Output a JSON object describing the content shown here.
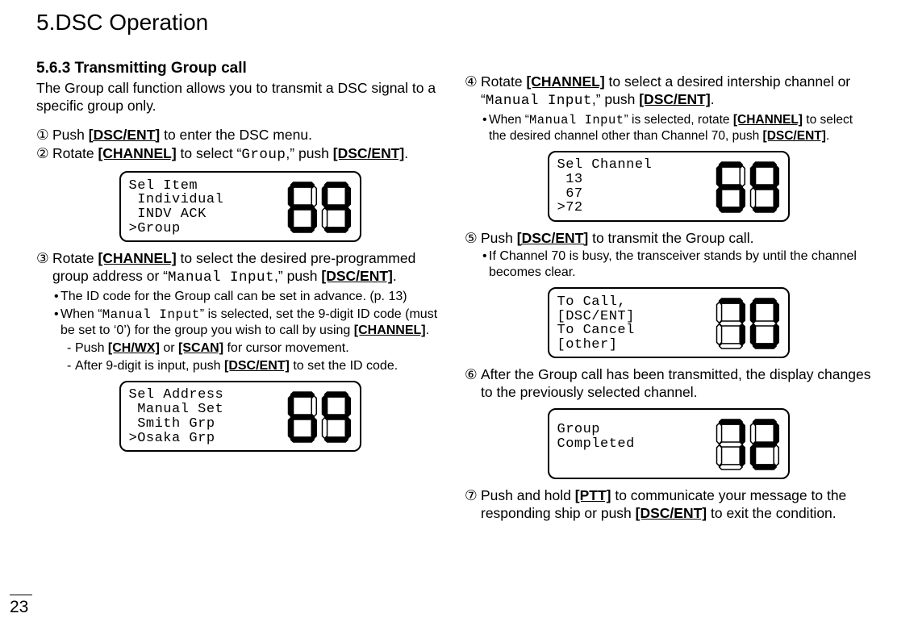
{
  "chapter_title": "5.DSC Operation",
  "section_title": "5.6.3 Transmitting Group call",
  "intro": "The Group call function allows you to transmit a DSC signal to a specific group only.",
  "page_number": "23",
  "keys": {
    "dsc_ent": "[DSC/ENT]",
    "channel": "[CHANNEL]",
    "ch_wx": "[CH/WX]",
    "scan": "[SCAN]",
    "ptt": "[PTT]"
  },
  "mono": {
    "group": "Group",
    "manual_input": "Manual Input"
  },
  "steps": {
    "s1_num": "①",
    "s1_a": "Push ",
    "s1_b": " to enter the DSC menu.",
    "s2_num": "②",
    "s2_a": "Rotate ",
    "s2_b": " to select “",
    "s2_c": ",” push ",
    "s2_d": ".",
    "s3_num": "③",
    "s3_a": "Rotate ",
    "s3_b": " to select the desired pre-programmed group address or “",
    "s3_c": ",” push ",
    "s3_d": ".",
    "s3_b1": "The ID code for the Group call can be set in advance. (p. 13)",
    "s3_b2a": "When “",
    "s3_b2b": "” is selected, set the 9-digit ID code (must be set to ‘0’) for the group you wish to call by using ",
    "s3_b2c": ".",
    "s3_d1a": "Push ",
    "s3_d1b": " or ",
    "s3_d1c": " for cursor movement.",
    "s3_d2a": "After 9-digit is input, push ",
    "s3_d2b": " to set the ID code.",
    "s4_num": "④",
    "s4_a": "Rotate ",
    "s4_b": " to select a desired intership channel or “",
    "s4_c": ",” push ",
    "s4_d": ".",
    "s4_b1a": "When “",
    "s4_b1b": "” is selected, rotate ",
    "s4_b1c": " to select the desired channel other than Channel 70, push ",
    "s4_b1d": ".",
    "s5_num": "⑤",
    "s5_a": "Push ",
    "s5_b": " to transmit the Group call.",
    "s5_b1": "If Channel 70 is busy, the transceiver stands by until the channel becomes clear.",
    "s6_num": "⑥",
    "s6_a": "After the Group call has been transmitted, the display changes to the previously selected channel.",
    "s7_num": "⑦",
    "s7_a": "Push and hold ",
    "s7_b": " to communicate your message to the responding ship or push ",
    "s7_c": " to exit the condition."
  },
  "lcd": {
    "d1": "Sel Item\n Individual\n INDV ACK\n˃Group",
    "d1_num": "69",
    "d2": "Sel Address\n Manual Set\n Smith Grp\n˃Osaka Grp",
    "d2_num": "69",
    "d3": "Sel Channel\n 13\n 67\n˃72",
    "d3_num": "69",
    "d4": "To Call,\n[DSC/ENT]\nTo Cancel\n[other]",
    "d4_num": "70",
    "d5": "Group\nCompleted\n\n",
    "d5_num": "72"
  }
}
